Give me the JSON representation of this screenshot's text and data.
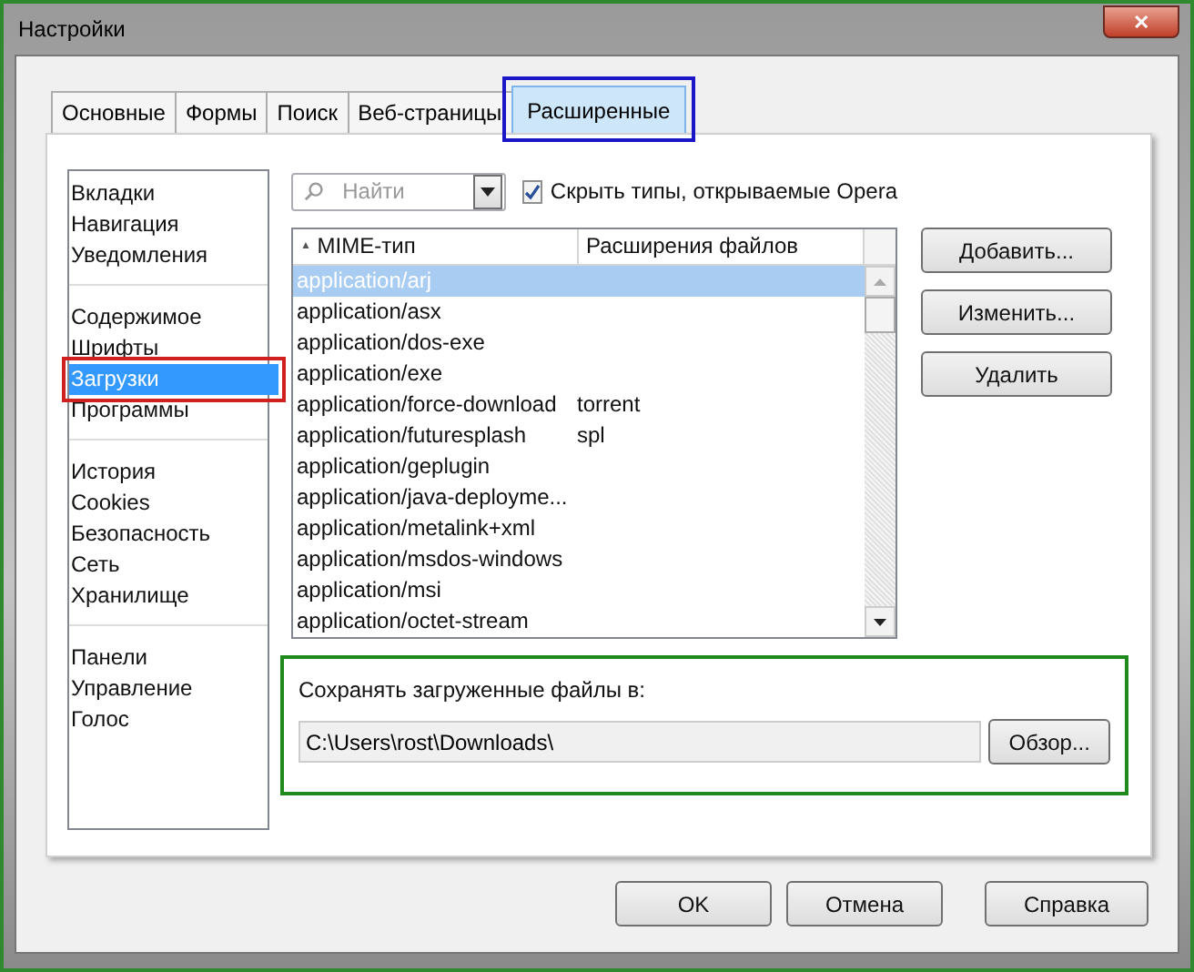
{
  "window": {
    "title": "Настройки",
    "close_icon": "✕"
  },
  "tabs": [
    {
      "label": "Основные",
      "selected": false,
      "highlighted": false
    },
    {
      "label": "Формы",
      "selected": false,
      "highlighted": false
    },
    {
      "label": "Поиск",
      "selected": false,
      "highlighted": false
    },
    {
      "label": "Веб-страницы",
      "selected": false,
      "highlighted": false
    },
    {
      "label": "Расширенные",
      "selected": true,
      "highlighted": true
    }
  ],
  "sidebar": {
    "groups": [
      {
        "items": [
          {
            "label": "Вкладки",
            "selected": false,
            "highlighted": false
          },
          {
            "label": "Навигация",
            "selected": false,
            "highlighted": false
          },
          {
            "label": "Уведомления",
            "selected": false,
            "highlighted": false
          }
        ]
      },
      {
        "items": [
          {
            "label": "Содержимое",
            "selected": false,
            "highlighted": false
          },
          {
            "label": "Шрифты",
            "selected": false,
            "highlighted": false
          },
          {
            "label": "Загрузки",
            "selected": true,
            "highlighted": true
          },
          {
            "label": "Программы",
            "selected": false,
            "highlighted": false
          }
        ]
      },
      {
        "items": [
          {
            "label": "История",
            "selected": false,
            "highlighted": false
          },
          {
            "label": "Cookies",
            "selected": false,
            "highlighted": false
          },
          {
            "label": "Безопасность",
            "selected": false,
            "highlighted": false
          },
          {
            "label": "Сеть",
            "selected": false,
            "highlighted": false
          },
          {
            "label": "Хранилище",
            "selected": false,
            "highlighted": false
          }
        ]
      },
      {
        "items": [
          {
            "label": "Панели",
            "selected": false,
            "highlighted": false
          },
          {
            "label": "Управление",
            "selected": false,
            "highlighted": false
          },
          {
            "label": "Голос",
            "selected": false,
            "highlighted": false
          }
        ]
      }
    ]
  },
  "search": {
    "placeholder": "Найти"
  },
  "hide_types": {
    "label": "Скрыть типы, открываемые Opera",
    "checked": true
  },
  "table": {
    "columns": [
      {
        "label": "MIME-тип",
        "sort_icon": "▲"
      },
      {
        "label": "Расширения файлов"
      }
    ],
    "rows": [
      {
        "cells": [
          "application/arj",
          ""
        ],
        "selected": true
      },
      {
        "cells": [
          "application/asx",
          ""
        ],
        "selected": false
      },
      {
        "cells": [
          "application/dos-exe",
          ""
        ],
        "selected": false
      },
      {
        "cells": [
          "application/exe",
          ""
        ],
        "selected": false
      },
      {
        "cells": [
          "application/force-download",
          "torrent"
        ],
        "selected": false
      },
      {
        "cells": [
          "application/futuresplash",
          "spl"
        ],
        "selected": false
      },
      {
        "cells": [
          "application/geplugin",
          ""
        ],
        "selected": false
      },
      {
        "cells": [
          "application/java-deployme...",
          ""
        ],
        "selected": false
      },
      {
        "cells": [
          "application/metalink+xml",
          ""
        ],
        "selected": false
      },
      {
        "cells": [
          "application/msdos-windows",
          ""
        ],
        "selected": false
      },
      {
        "cells": [
          "application/msi",
          ""
        ],
        "selected": false
      },
      {
        "cells": [
          "application/octet-stream",
          ""
        ],
        "selected": false
      }
    ]
  },
  "side_buttons": [
    "Добавить...",
    "Изменить...",
    "Удалить"
  ],
  "downloads": {
    "label": "Сохранять загруженные файлы в:",
    "path": "C:\\Users\\rost\\Downloads\\",
    "browse": "Обзор...",
    "highlighted": true
  },
  "buttons": [
    "OK",
    "Отмена",
    "Справка"
  ]
}
